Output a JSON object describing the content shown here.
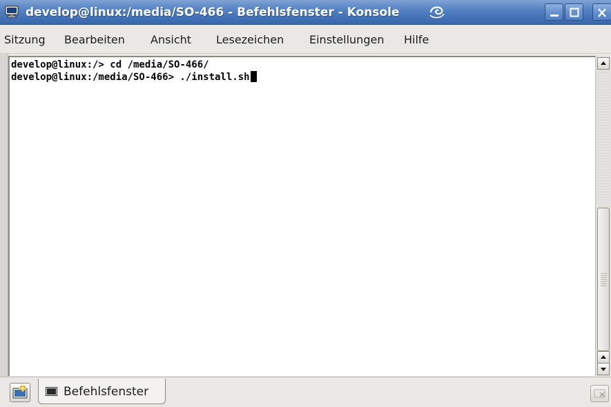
{
  "window": {
    "title": "develop@linux:/media/SO-466 - Befehlsfenster - Konsole",
    "app_icon": "terminal-icon",
    "controls": [
      "minimize-icon",
      "maximize-icon",
      "close-icon"
    ]
  },
  "menubar": {
    "items": [
      {
        "label": "Sitzung"
      },
      {
        "label": "Bearbeiten"
      },
      {
        "label": "Ansicht"
      },
      {
        "label": "Lesezeichen"
      },
      {
        "label": "Einstellungen"
      },
      {
        "label": "Hilfe"
      }
    ]
  },
  "terminal": {
    "lines": [
      "develop@linux:/> cd /media/SO-466/",
      "develop@linux:/media/SO-466> ./install.sh"
    ]
  },
  "tabs": {
    "items": [
      {
        "label": "Befehlsfenster",
        "icon": "terminal-tab-icon"
      }
    ],
    "new_tab_icon": "new-session-icon",
    "close_tab_icon": "close-session-icon"
  },
  "colors": {
    "titlebar": "#4472b7",
    "terminal_bg": "#ffffff",
    "terminal_fg": "#000000"
  }
}
